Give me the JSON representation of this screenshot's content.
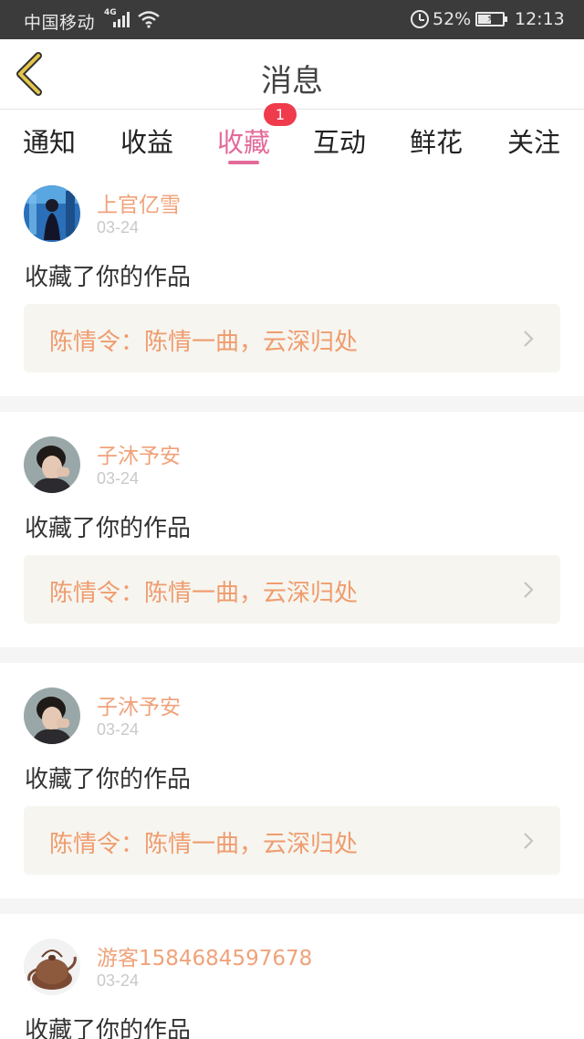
{
  "status_bar": {
    "carrier": "中国移动",
    "network": "4G",
    "battery": "52%",
    "time": "12:13"
  },
  "header": {
    "title": "消息",
    "back_icon": "chevron-left-icon"
  },
  "tabs": {
    "items": [
      {
        "label": "通知"
      },
      {
        "label": "收益"
      },
      {
        "label": "收藏"
      },
      {
        "label": "互动"
      },
      {
        "label": "鲜花"
      },
      {
        "label": "关注"
      }
    ],
    "active_index": 2,
    "badge": "1"
  },
  "messages": [
    {
      "user": "上官亿雪",
      "date": "03-24",
      "text": "收藏了你的作品",
      "work": "陈情令：陈情一曲，云深归处"
    },
    {
      "user": "子沐予安",
      "date": "03-24",
      "text": "收藏了你的作品",
      "work": "陈情令：陈情一曲，云深归处"
    },
    {
      "user": "子沐予安",
      "date": "03-24",
      "text": "收藏了你的作品",
      "work": "陈情令：陈情一曲，云深归处"
    },
    {
      "user": "游客1584684597678",
      "date": "03-24",
      "text": "收藏了你的作品",
      "work": ""
    }
  ],
  "colors": {
    "accent": "#e36a9a",
    "username": "#f0a27a",
    "work_title": "#ef9c6e",
    "badge": "#f03b4c",
    "back_icon": "#d4b23a"
  }
}
